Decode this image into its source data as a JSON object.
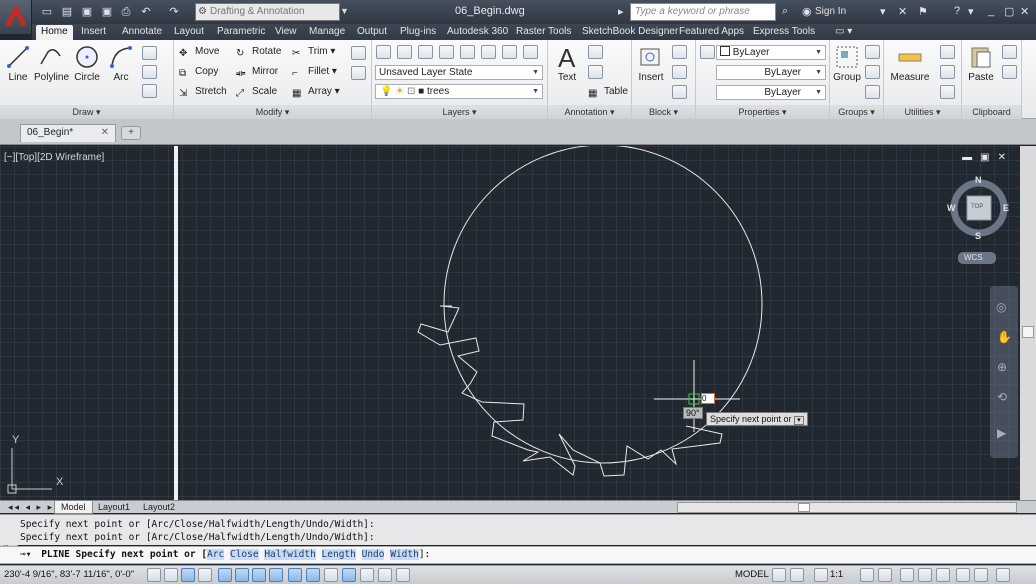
{
  "titlebar": {
    "workspace": "Drafting & Annotation",
    "document_title": "06_Begin.dwg",
    "search_placeholder": "Type a keyword or phrase",
    "sign_in": "Sign In"
  },
  "ribbon_tabs": [
    "Home",
    "Insert",
    "Annotate",
    "Layout",
    "Parametric",
    "View",
    "Manage",
    "Output",
    "Plug-ins",
    "Autodesk 360",
    "Raster Tools",
    "SketchBook Designer",
    "Featured Apps",
    "Express Tools"
  ],
  "draw": {
    "title": "Draw",
    "line": "Line",
    "polyline": "Polyline",
    "circle": "Circle",
    "arc": "Arc"
  },
  "modify": {
    "title": "Modify",
    "move": "Move",
    "rotate": "Rotate",
    "trim": "Trim",
    "copy": "Copy",
    "mirror": "Mirror",
    "fillet": "Fillet",
    "stretch": "Stretch",
    "scale": "Scale",
    "array": "Array"
  },
  "layers": {
    "title": "Layers",
    "state": "Unsaved Layer State",
    "current": "trees"
  },
  "annotation": {
    "title": "Annotation",
    "text": "Text",
    "table": "Table"
  },
  "block": {
    "title": "Block",
    "insert": "Insert"
  },
  "properties": {
    "title": "Properties",
    "color": "ByLayer",
    "linetype": "ByLayer",
    "lineweight": "ByLayer"
  },
  "groups": {
    "title": "Groups",
    "group": "Group"
  },
  "utilities": {
    "title": "Utilities",
    "measure": "Measure"
  },
  "clipboard": {
    "title": "Clipboard",
    "paste": "Paste"
  },
  "file_tab": "06_Begin*",
  "viewport": {
    "label": "[−][Top][2D Wireframe]",
    "compass": {
      "n": "N",
      "s": "S",
      "e": "E",
      "w": "W",
      "top": "TOP",
      "wcs": "WCS"
    },
    "ucs_x": "X",
    "ucs_y": "Y",
    "tip_angle": "90°",
    "tip_input": "0",
    "tip_prompt": "Specify next point or"
  },
  "layout_tabs": [
    "Model",
    "Layout1",
    "Layout2"
  ],
  "command": {
    "history": [
      "Specify next point or [Arc/Close/Halfwidth/Length/Undo/Width]:",
      "Specify next point or [Arc/Close/Halfwidth/Length/Undo/Width]:"
    ],
    "current_prefix": "PLINE Specify next point or [",
    "options": [
      "Arc",
      "Close",
      "Halfwidth",
      "Length",
      "Undo",
      "Width"
    ],
    "current_suffix": "]:"
  },
  "status": {
    "coords": "230'-4 9/16\", 83'-7 11/16\", 0'-0\"",
    "model": "MODEL",
    "scale": "1:1"
  },
  "colors": {
    "app_red": "#c8281e",
    "canvas": "#212830",
    "option_highlight": "#c8daf3"
  }
}
